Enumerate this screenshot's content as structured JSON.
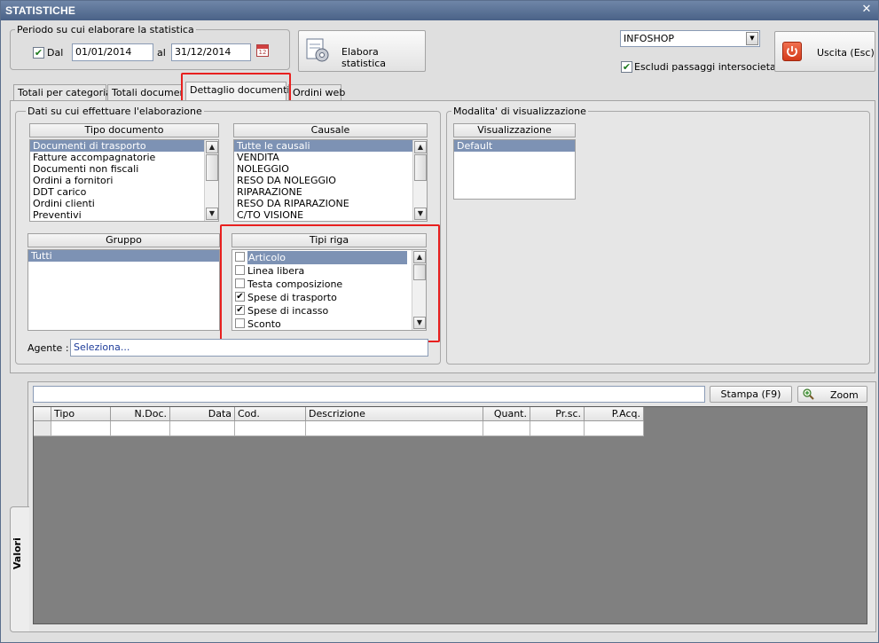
{
  "window": {
    "title": "STATISTICHE",
    "close_glyph": "✕"
  },
  "period": {
    "group_label": "Periodo su cui elaborare la statistica",
    "from_checked": true,
    "from_label": "Dal",
    "from_value": "01/01/2014",
    "to_label": "al",
    "to_value": "31/12/2014",
    "calendar_icon": "calendar-icon"
  },
  "elabora_button": {
    "label": "Elabora statistica",
    "icon": "chart-gear-icon"
  },
  "company_select": {
    "value": "INFOSHOP"
  },
  "escludi": {
    "checked": true,
    "label": "Escludi passaggi intersocietari"
  },
  "exit_button": {
    "label": "Uscita (Esc)",
    "icon": "power-icon"
  },
  "tabs": [
    {
      "label": "Totali per categoria"
    },
    {
      "label": "Totali document"
    },
    {
      "label": "Dettaglio documenti",
      "active": true
    },
    {
      "label": "Ordini web"
    }
  ],
  "data_group": {
    "label": "Dati su cui effettuare l'elaborazione",
    "tipo_documento": {
      "header": "Tipo documento",
      "items": [
        "Documenti di trasporto",
        "Fatture accompagnatorie",
        "Documenti non fiscali",
        "Ordini a fornitori",
        "DDT carico",
        "Ordini clienti",
        "Preventivi"
      ],
      "selected": 0
    },
    "causale": {
      "header": "Causale",
      "items": [
        "Tutte le causali",
        "VENDITA",
        "NOLEGGIO",
        "RESO DA NOLEGGIO",
        "RIPARAZIONE",
        "RESO DA RIPARAZIONE",
        "C/TO VISIONE"
      ],
      "selected": 0
    },
    "gruppo": {
      "header": "Gruppo",
      "items": [
        "Tutti"
      ],
      "selected": 0
    },
    "tipi_riga": {
      "header": "Tipi riga",
      "items": [
        {
          "label": "Articolo",
          "checked": false
        },
        {
          "label": "Linea libera",
          "checked": false
        },
        {
          "label": "Testa composizione",
          "checked": false
        },
        {
          "label": "Spese di trasporto",
          "checked": true
        },
        {
          "label": "Spese di incasso",
          "checked": true
        },
        {
          "label": "Sconto",
          "checked": false
        }
      ],
      "selected": 0
    },
    "agente": {
      "label": "Agente :",
      "value": "Seleziona..."
    }
  },
  "visual_group": {
    "label": "Modalita' di visualizzazione",
    "header": "Visualizzazione",
    "items": [
      "Default"
    ],
    "selected": 0
  },
  "bottom": {
    "side_tab": "Valori",
    "stampa_label": "Stampa (F9)",
    "zoom_label": "Zoom",
    "zoom_icon": "zoom-in-icon",
    "columns": [
      "Tipo",
      "N.Doc.",
      "Data",
      "Cod.",
      "Descrizione",
      "Quant.",
      "Pr.sc.",
      "P.Acq."
    ]
  },
  "colors": {
    "selection": "#7D92B4",
    "highlight": "#E8201F",
    "titlebar": "#4A6287"
  }
}
